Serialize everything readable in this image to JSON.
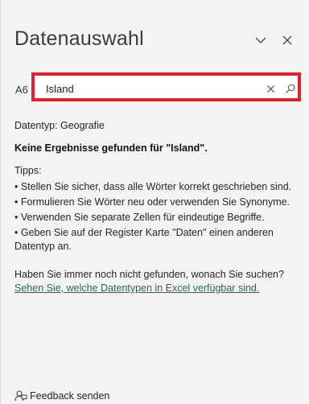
{
  "pane": {
    "title": "Datenauswahl",
    "icons": {
      "collapse": "chevron-down-icon",
      "close": "close-icon"
    }
  },
  "search": {
    "cell_ref": "A6",
    "value": "Island",
    "icons": {
      "clear": "close-icon",
      "search": "search-icon"
    }
  },
  "content": {
    "datatype": "Datentyp: Geografie",
    "no_results": "Keine Ergebnisse gefunden für \"Island\".",
    "tips_label": "Tipps:",
    "tips": [
      "• Stellen Sie sicher, dass alle Wörter korrekt geschrieben sind.",
      "• Formulieren Sie Wörter neu oder verwenden Sie Synonyme.",
      "• Verwenden Sie separate Zellen für eindeutige Begriffe.",
      "• Geben Sie auf der Register Karte \"Daten\" einen anderen Datentyp an."
    ],
    "still_question": "Haben Sie immer noch nicht gefunden, wonach Sie suchen?",
    "link": "Sehen Sie, welche Datentypen in Excel verfügbar sind."
  },
  "footer": {
    "feedback_label": "Feedback senden",
    "feedback_icon": "feedback-icon"
  },
  "colors": {
    "highlight_border": "#e5202b",
    "link": "#1e7145",
    "background": "#f3f3f3"
  }
}
